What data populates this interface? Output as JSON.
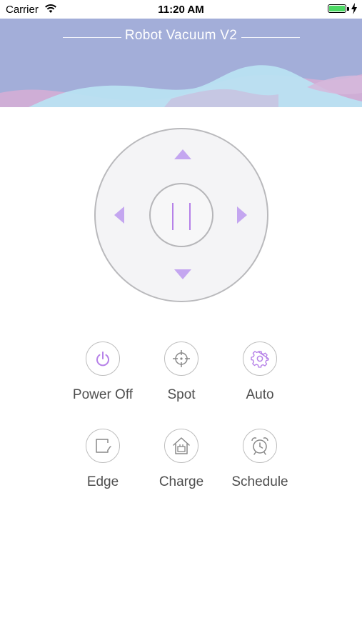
{
  "status_bar": {
    "carrier": "Carrier",
    "time": "11:20 AM"
  },
  "header": {
    "title": "Robot Vacuum V2"
  },
  "colors": {
    "header_bg": "#a3aed9",
    "wave_purple": "#cfaed6",
    "wave_cyan": "#b9e2f2",
    "accent": "#b681e8"
  },
  "functions": [
    {
      "label": "Power Off",
      "icon": "power-icon"
    },
    {
      "label": "Spot",
      "icon": "spot-crosshair-icon"
    },
    {
      "label": "Auto",
      "icon": "gear-icon"
    },
    {
      "label": "Edge",
      "icon": "edge-icon"
    },
    {
      "label": "Charge",
      "icon": "charging-dock-icon"
    },
    {
      "label": "Schedule",
      "icon": "alarm-clock-icon"
    }
  ]
}
